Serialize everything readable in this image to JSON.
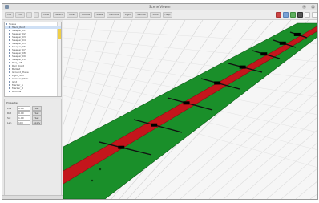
{
  "window": {
    "title": "Scene Viewer"
  },
  "toolbar": {
    "items": [
      {
        "label": "File",
        "icon": "file-icon"
      },
      {
        "label": "Edit",
        "icon": "edit-icon"
      },
      {
        "label": "",
        "icon": "undo-icon"
      },
      {
        "label": "",
        "icon": "redo-icon"
      },
      {
        "label": "View",
        "icon": "view-icon"
      },
      {
        "label": "Select",
        "icon": "select-icon"
      },
      {
        "label": "Move",
        "icon": "move-icon"
      },
      {
        "label": "Rotate",
        "icon": "rotate-icon"
      },
      {
        "label": "Scale",
        "icon": "scale-icon"
      },
      {
        "label": "Camera",
        "icon": "camera-icon"
      },
      {
        "label": "Light",
        "icon": "light-icon"
      },
      {
        "label": "Render",
        "icon": "render-icon"
      },
      {
        "label": "Tools",
        "icon": "tools-icon"
      },
      {
        "label": "Help",
        "icon": "help-icon"
      }
    ],
    "color_icons": [
      "red",
      "blue",
      "green",
      "dark",
      "white",
      "white"
    ]
  },
  "tree": {
    "items": [
      "Scene",
      "Track_Root",
      "Sleeper_01",
      "Sleeper_02",
      "Sleeper_03",
      "Sleeper_04",
      "Sleeper_05",
      "Sleeper_06",
      "Sleeper_07",
      "Sleeper_08",
      "Sleeper_09",
      "Sleeper_10",
      "Rail_Left",
      "Rail_Right",
      "Ballast",
      "Ground_Plane",
      "Light_Sun",
      "Camera_Main",
      "Grid",
      "Marker_A",
      "Marker_B",
      "Bounds"
    ]
  },
  "properties": {
    "header": "Properties",
    "rows": [
      {
        "label": "Pos",
        "value": "0.00",
        "button": "Set"
      },
      {
        "label": "Rot",
        "value": "0.00",
        "button": "Set"
      },
      {
        "label": "Scl",
        "value": "1.00",
        "button": "Set"
      },
      {
        "label": "Len",
        "value": "100",
        "button": "Apply"
      }
    ]
  },
  "colors": {
    "ground": "#1a8f2a",
    "track": "#c4161c",
    "sleeper": "#111111",
    "selection": "#f0cf48"
  }
}
